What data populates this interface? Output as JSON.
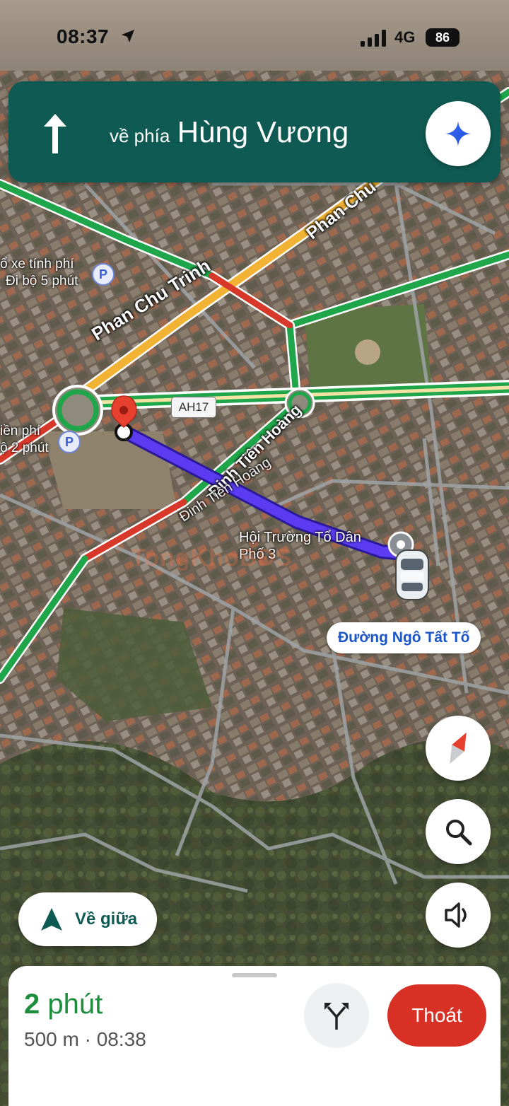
{
  "status_bar": {
    "time": "08:37",
    "network": "4G",
    "battery": "86",
    "icons": [
      "location-arrow-icon",
      "signal-bars-icon",
      "battery-icon"
    ]
  },
  "banner": {
    "prefix": "về phía",
    "street": "Hùng Vương",
    "icon": "straight-arrow-icon",
    "action_icon": "gemini-sparkle-icon"
  },
  "map": {
    "road_labels": {
      "phan_chu_trinh_main": "Phan Chu Trinh",
      "phan_chu_upper": "Phan Chu",
      "dinh_tien_hoang_upper": "Đinh Tiên Hoàng",
      "dinh_tien_hoang_lower": "Đinh Tiên Hoàng",
      "highway_shield": "AH17"
    },
    "poi": {
      "parking_1_line1": "ổ xe tính phí",
      "parking_1_line2": "Đi bộ 5 phút",
      "parking_2_line1": "iền phí",
      "parking_2_line2": "ộ 2 phút",
      "parking_symbol": "P",
      "destination_line1": "Hội Trường Tổ Dân",
      "destination_line2": "Phố 3"
    },
    "current_street_chip": "Đường Ngô Tất Tố",
    "watermark": "TongKhoBĐS",
    "colors": {
      "route": "#5b3cf2",
      "traffic_green": "#1fa64a",
      "traffic_yellow": "#f2b234",
      "traffic_red": "#d8382a",
      "pin": "#e8402f"
    }
  },
  "controls": {
    "compass_icon": "compass-icon",
    "search_icon": "search-icon",
    "sound_icon": "volume-icon",
    "recenter_label": "Về giữa",
    "recenter_icon": "navigation-arrow-icon"
  },
  "sheet": {
    "duration_value": "2",
    "duration_unit": "phút",
    "details": "500 m · 08:38",
    "alt_routes_icon": "route-fork-icon",
    "exit_label": "Thoát"
  }
}
